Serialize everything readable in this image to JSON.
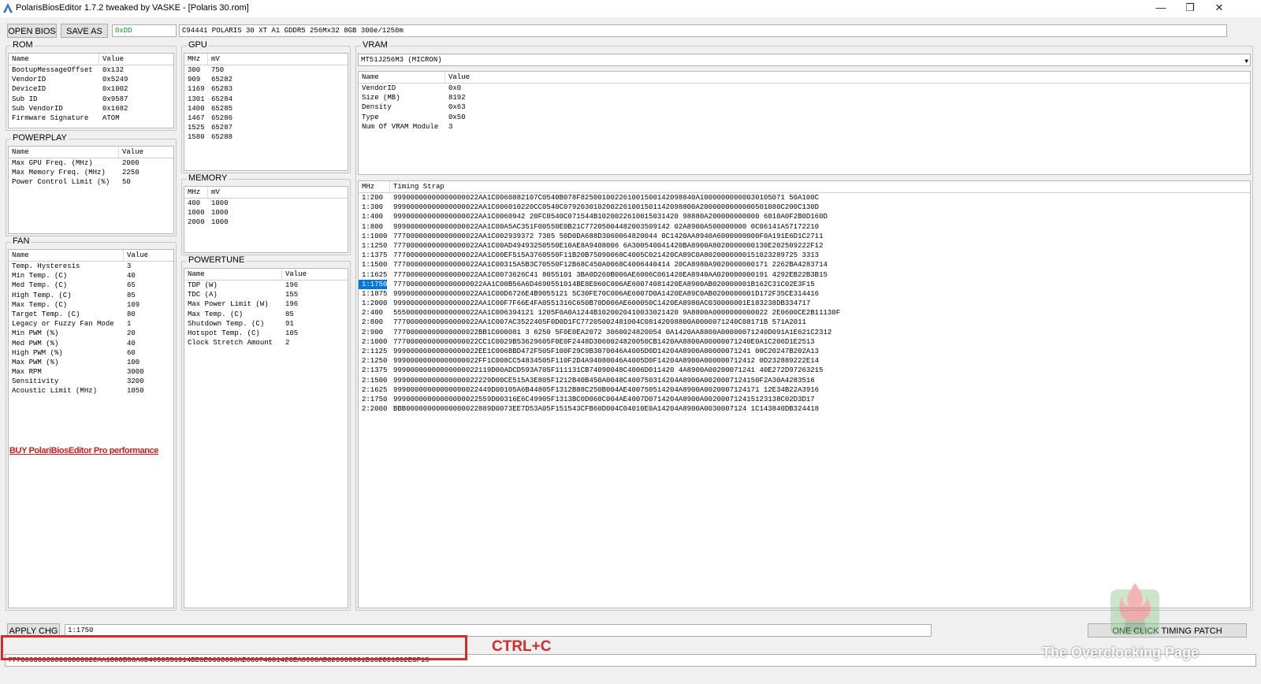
{
  "window": {
    "title": "PolarisBiosEditor 1.7.2 tweaked by VASKE - [Polaris 30.rom]",
    "minimize": "—",
    "restore": "❐",
    "close": "✕"
  },
  "toolbar": {
    "open_label": "OPEN BIOS",
    "save_label": "SAVE AS",
    "checksum": "0xDD",
    "bios_info": "C94441 POLARIS 30 XT A1 GDDR5 256Mx32 8GB 300e/1250m"
  },
  "rom": {
    "legend": "ROM",
    "headers": [
      "Name",
      "Value"
    ],
    "rows": [
      [
        "BootupMessageOffset",
        "0x132"
      ],
      [
        "VendorID",
        "0x5249"
      ],
      [
        "DeviceID",
        "0x1002"
      ],
      [
        "Sub ID",
        "0x9587"
      ],
      [
        "Sub VendorID",
        "0x1682"
      ],
      [
        "Firmware Signature",
        "ATOM"
      ]
    ]
  },
  "powerplay": {
    "legend": "POWERPLAY",
    "headers": [
      "Name",
      "Value"
    ],
    "rows": [
      [
        "Max GPU Freq. (MHz)",
        "2000"
      ],
      [
        "Max Memory Freq. (MHz)",
        "2250"
      ],
      [
        "Power Control Limit (%)",
        "50"
      ]
    ]
  },
  "fan": {
    "legend": "FAN",
    "headers": [
      "Name",
      "Value"
    ],
    "rows": [
      [
        "Temp. Hysteresis",
        "3"
      ],
      [
        "Min Temp. (C)",
        "40"
      ],
      [
        "Med Temp. (C)",
        "65"
      ],
      [
        "High Temp. (C)",
        "85"
      ],
      [
        "Max Temp. (C)",
        "109"
      ],
      [
        "Target Temp. (C)",
        "80"
      ],
      [
        "Legacy or Fuzzy Fan Mode",
        "1"
      ],
      [
        "Min PWM (%)",
        "20"
      ],
      [
        "Med PWM (%)",
        "40"
      ],
      [
        "High PWM (%)",
        "60"
      ],
      [
        "Max PWM (%)",
        "100"
      ],
      [
        "Max RPM",
        "3000"
      ],
      [
        "Sensitivity",
        "3200"
      ],
      [
        "Acoustic Limit (MHz)",
        "1050"
      ]
    ],
    "buy_link": "BUY PolariBiosEditor Pro performance"
  },
  "gpu": {
    "legend": "GPU",
    "headers": [
      "MHz",
      "mV"
    ],
    "rows": [
      [
        "300",
        "750"
      ],
      [
        "909",
        "65282"
      ],
      [
        "1169",
        "65283"
      ],
      [
        "1301",
        "65284"
      ],
      [
        "1400",
        "65285"
      ],
      [
        "1467",
        "65286"
      ],
      [
        "1525",
        "65287"
      ],
      [
        "1580",
        "65288"
      ]
    ]
  },
  "memory": {
    "legend": "MEMORY",
    "headers": [
      "MHz",
      "mV"
    ],
    "rows": [
      [
        "400",
        "1000"
      ],
      [
        "1000",
        "1000"
      ],
      [
        "2000",
        "1000"
      ]
    ]
  },
  "powertune": {
    "legend": "POWERTUNE",
    "headers": [
      "Name",
      "Value"
    ],
    "rows": [
      [
        "TDP (W)",
        "196"
      ],
      [
        "TDC (A)",
        "155"
      ],
      [
        "Max Power Limit (W)",
        "196"
      ],
      [
        "Max Temp. (C)",
        "85"
      ],
      [
        "Shutdown Temp. (C)",
        "91"
      ],
      [
        "Hotspot Temp. (C)",
        "105"
      ],
      [
        "Clock Stretch Amount",
        "2"
      ]
    ]
  },
  "vram": {
    "legend": "VRAM",
    "selected_module": "MT51J256M3 (MICRON)",
    "headers": [
      "Name",
      "Value"
    ],
    "rows": [
      [
        "VendorID",
        "0x0"
      ],
      [
        "Size (MB)",
        "8192"
      ],
      [
        "Density",
        "0x63"
      ],
      [
        "Type",
        "0x50"
      ],
      [
        "Num Of VRAM Module",
        "3"
      ]
    ]
  },
  "timings": {
    "headers": [
      "MHz",
      "Timing Strap"
    ],
    "selected_index": 9,
    "rows": [
      [
        "1:200",
        "99900000000000000022AA1C0060882107C0540B078F825001002261001500142098840A10000000000030105071 50A100C"
      ],
      [
        "1:300",
        "99900000000000000022AA1C006010220CC0540C0792030102002261001501142098800A2000000000000501080C200C130D"
      ],
      [
        "1:400",
        "99900000000000000022AA1C0060942 20FC0540C071544B1020022610015031420 98880A200000000000 6010A0F2B0D160D"
      ],
      [
        "1:800",
        "99900000000000000022AA1C00A5AC351F00550E0B21C77205004482003509142 02A8900A500000000 0C06141A57172210"
      ],
      [
        "1:1000",
        "77700000000000000022AA1C002939372 7305 50D0DA688D3060064820044 0C1420AA8940A6000000000F0A191E6D1C2711"
      ],
      [
        "1:1250",
        "77700000000000000022AA1C00AD49493250550E10AE8A9408006 6A300540041420BA8900A8020000000130E202509222F12"
      ],
      [
        "1:1375",
        "77700000000000000022AA1C00EF515A3760550F11B20B75090068C4005C021420CA89C0A8020000000151023289725 3313"
      ],
      [
        "1:1500",
        "77700000000000000022AA1C00315A5B3C70550F12B68C450A0068C4006440414 20CA8980A9020000000171 2262BA4283714"
      ],
      [
        "1:1625",
        "77700000000000000022AA1C0073626C41 8055101 3BA0D260B006AE6006C061420EA8940AA020000000191 4292EB22B3B15"
      ],
      [
        "1:1750",
        "777000000000000000022AA1C00B56A6D4690551014BE8E060C006AE60074081420EA8900AB020000001B162C31C02E3F15"
      ],
      [
        "1:1875",
        "99900000000000000022AA1C00D6726E4B9055121 5C30FE70C006AE6007D0A1420EA89C0AB0200000001D172F35CE314416"
      ],
      [
        "1:2000",
        "99900000000000000022AA1C00F7F66E4FA0551316C650B70D006AE600050C1420EA8980AC030000001E183238DB334717"
      ],
      [
        "2:400",
        "55500000000000000022AA1C006394121 1205F0A0A1244B1020020410033021420 9A8800A0000000000022 2E0600CE2B11130F"
      ],
      [
        "2:800",
        "77700000000000000022AA1C007AC3522405F0D0D1FC77205002481004C08142098800A0000071240C08171B 571A2011"
      ],
      [
        "2:900",
        "77700000000000000022BB1C000081 3 6250 5F0E0EA2072 3060024820054 0A1420AA8800A00000071240D091A1E621C2312"
      ],
      [
        "2:1000",
        "77700000000000000022CC1C0029B53629605F0E0F2448D3060024820050CB1420AA8800A00000071240E0A1C206D1E2513"
      ],
      [
        "2:1125",
        "99900000000000000022EE1C006BBD472F505F100F29C9B3070046A4005D0D14204A8900A00000071241 00C20247B202A13"
      ],
      [
        "2:1250",
        "99900000000000000022FF1C008CC54834505F110F2D4A94080046A4005D0F14204A8900A000000712412 0D232889222E14"
      ],
      [
        "2:1375",
        "99900000000000000022119D00ADCD593A705F111131CB74090048C4006D011420 4A8900A00200071241 40E272D97263215"
      ],
      [
        "2:1500",
        "99900000000000000022229D00CE515A3E805F1212B40B450A0048C400750314204A8900A0020007124150F2A30A4283516"
      ],
      [
        "2:1625",
        "99900000000000000022449D00105A6B44805F1312B88C250B004AE400750514204A8900A0020007124171 12E34B22A3916"
      ],
      [
        "2:1750",
        "99900000000000000022559D00316E6C49905F1313BC0D060C004AE4007D0714204A8900A002000712415123138C02D3D17"
      ],
      [
        "2:2000",
        "BBB00000000000000022889D0073EE7D53A05F151543CFB60D004C04010E0A14204A8900A0030007124 1C143840DB324418"
      ]
    ]
  },
  "bottom": {
    "apply_label": "APPLY CHG",
    "selected_strap": "1:1750",
    "one_click_label": "ONE CLICK TIMING PATCH",
    "strap_value": "777000000000000000022AA1C00B56A6D4690551014BE8E060C006AE60074081420EA8900AB020000001B162C31C02E3F15",
    "annotation": "CTRL+C",
    "watermark": "The Overclocking Page"
  }
}
